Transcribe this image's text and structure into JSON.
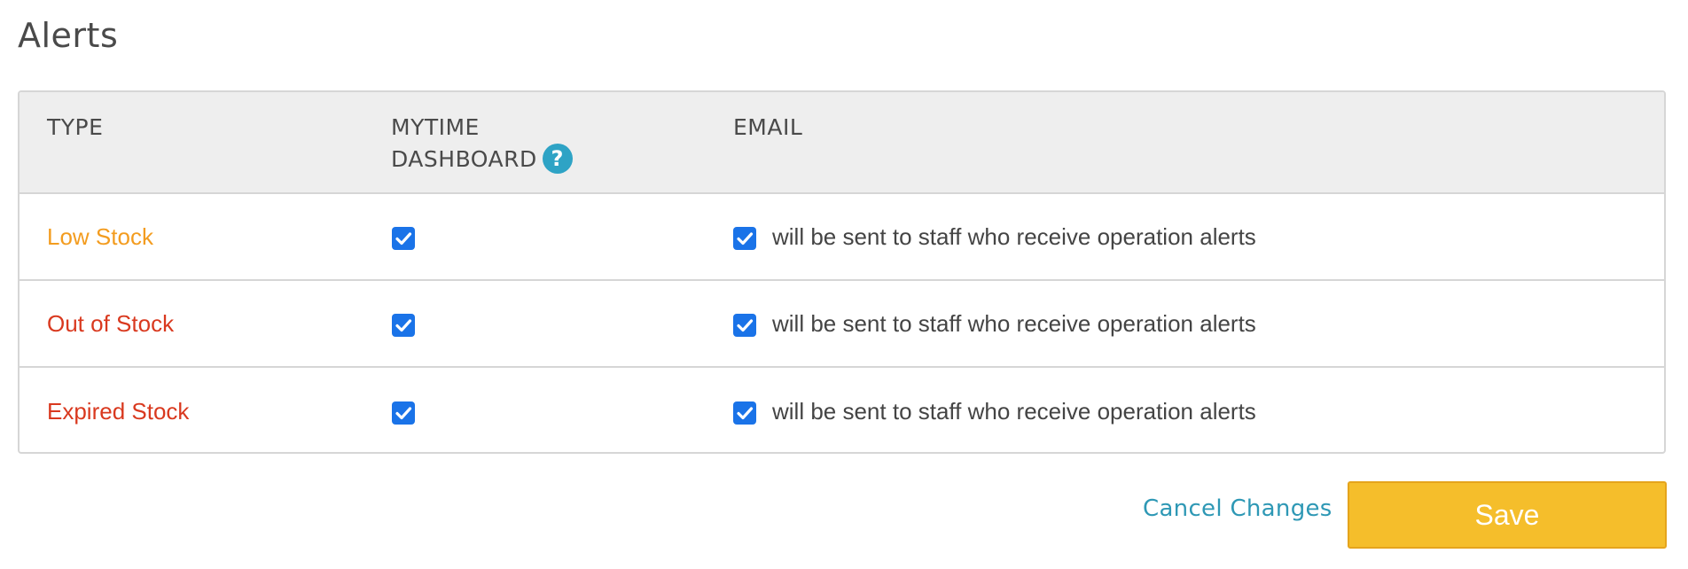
{
  "page": {
    "title": "Alerts"
  },
  "table": {
    "headers": {
      "type": "TYPE",
      "dashboard_line1": "MYTIME",
      "dashboard_line2": "DASHBOARD",
      "email": "EMAIL",
      "help_icon_glyph": "?"
    },
    "rows": [
      {
        "type": "Low Stock",
        "type_color": "#f39c1f",
        "dashboard_checked": true,
        "email_checked": true,
        "email_text": "will be sent to staff who receive operation alerts"
      },
      {
        "type": "Out of Stock",
        "type_color": "#d9391f",
        "dashboard_checked": true,
        "email_checked": true,
        "email_text": "will be sent to staff who receive operation alerts"
      },
      {
        "type": "Expired Stock",
        "type_color": "#d9391f",
        "dashboard_checked": true,
        "email_checked": true,
        "email_text": "will be sent to staff who receive operation alerts"
      }
    ]
  },
  "actions": {
    "cancel_label": "Cancel Changes",
    "save_label": "Save"
  },
  "colors": {
    "checkbox": "#1a73e8",
    "help_icon": "#2ea3c5",
    "save_button": "#f5be2b",
    "cancel_link": "#2e98b5"
  },
  "icons": {
    "help": "question-circle-icon",
    "checkbox": "checkmark-icon"
  }
}
